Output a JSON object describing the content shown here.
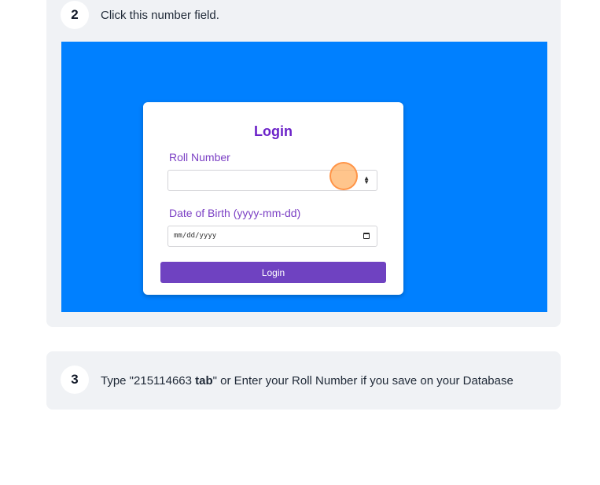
{
  "steps": [
    {
      "number": "2",
      "instruction": "Click this number field.",
      "screenshot": {
        "login_title": "Login",
        "roll_label": "Roll Number",
        "roll_value": "",
        "dob_label": "Date of Birth (yyyy-mm-dd)",
        "dob_placeholder": "mm/dd/yyyy",
        "button_label": "Login",
        "background_color": "#0080ff",
        "button_color": "#6f42c1"
      }
    },
    {
      "number": "3",
      "instruction_prefix": "Type \"215114663 ",
      "instruction_bold": "tab",
      "instruction_suffix": "\" or Enter your Roll Number if you save on your Database"
    }
  ],
  "icons": {
    "number_spinner": "spinner-arrows-icon",
    "date_picker": "calendar-icon",
    "click_indicator": "click-marker"
  }
}
